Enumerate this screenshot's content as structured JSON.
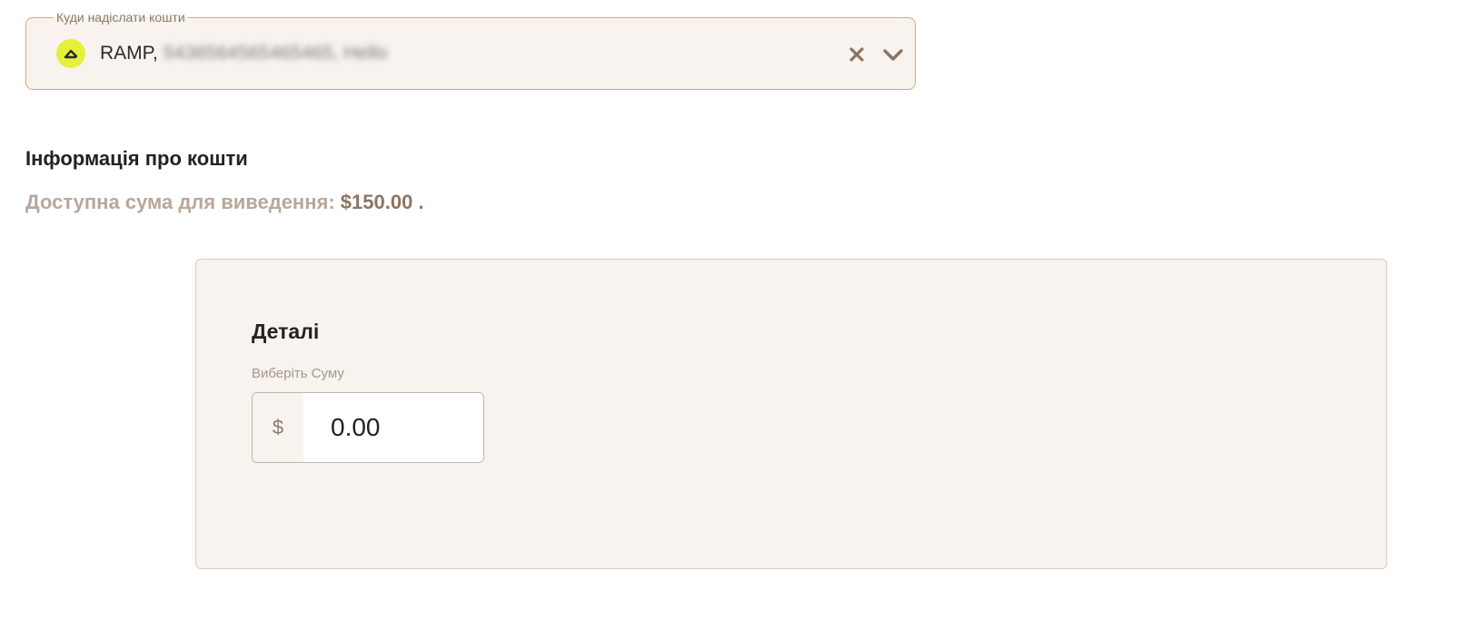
{
  "destination": {
    "legend": "Куди надіслати кошти",
    "provider_name": "RAMP,",
    "account_details": "5436564565465465, Hello",
    "provider_logo_icon": "ramp-logo-icon",
    "clear_icon": "close-icon",
    "expand_icon": "chevron-down-icon"
  },
  "funds_info": {
    "title": "Інформація про кошти",
    "available_label": "Доступна сума для виведення:",
    "available_amount": "$150.00",
    "available_suffix": "."
  },
  "details": {
    "title": "Деталі",
    "amount_label": "Виберіть Суму",
    "currency_symbol": "$",
    "amount_value": "0.00"
  },
  "colors": {
    "accent_border": "#d6ab76",
    "field_background": "#f8f3ee",
    "icon_brown": "#8c7462",
    "logo_yellow": "#e4f03a"
  }
}
